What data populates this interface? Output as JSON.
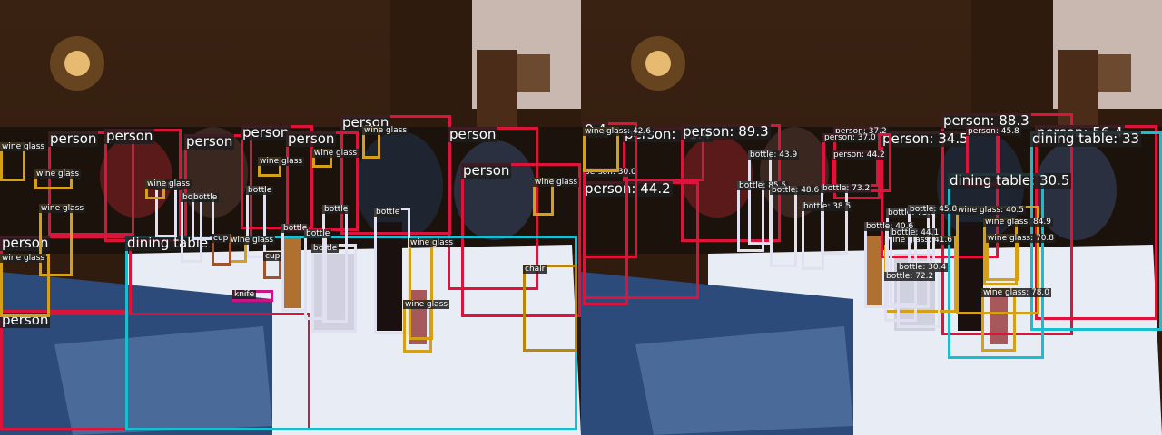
{
  "colors": {
    "person": "#dc143c",
    "dining table": "#17becf",
    "bottle": "#e0e0f0",
    "wine glass": "#d4a017",
    "cup": "#a0522d",
    "knife": "#c71585",
    "chair": "#b8860b"
  },
  "left_panel": {
    "detections": [
      {
        "cls": "person",
        "label": "person"
      },
      {
        "cls": "person",
        "label": "person"
      },
      {
        "cls": "person",
        "label": "person"
      },
      {
        "cls": "person",
        "label": "person"
      },
      {
        "cls": "person",
        "label": "person"
      },
      {
        "cls": "person",
        "label": "person"
      },
      {
        "cls": "person",
        "label": "person"
      },
      {
        "cls": "person",
        "label": "person"
      },
      {
        "cls": "person",
        "label": "person"
      },
      {
        "cls": "person",
        "label": "person"
      },
      {
        "cls": "dining table",
        "label": "dining table"
      },
      {
        "cls": "chair",
        "label": "chair"
      },
      {
        "cls": "bottle",
        "label": "bottle"
      },
      {
        "cls": "bottle",
        "label": "bottle"
      },
      {
        "cls": "bottle",
        "label": "bottle"
      },
      {
        "cls": "bottle",
        "label": "bottle"
      },
      {
        "cls": "bottle",
        "label": "bottle"
      },
      {
        "cls": "bottle",
        "label": "bottle"
      },
      {
        "cls": "bottle",
        "label": "bottle"
      },
      {
        "cls": "bottle",
        "label": "bottle"
      },
      {
        "cls": "bottle",
        "label": "bottle"
      },
      {
        "cls": "wine glass",
        "label": "wine glass"
      },
      {
        "cls": "wine glass",
        "label": "wine glass"
      },
      {
        "cls": "wine glass",
        "label": "wine glass"
      },
      {
        "cls": "wine glass",
        "label": "wine glass"
      },
      {
        "cls": "wine glass",
        "label": "wine glass"
      },
      {
        "cls": "wine glass",
        "label": "wine glass"
      },
      {
        "cls": "wine glass",
        "label": "wine glass"
      },
      {
        "cls": "wine glass",
        "label": "wine glass"
      },
      {
        "cls": "wine glass",
        "label": "wine glass"
      },
      {
        "cls": "wine glass",
        "label": "wine glass"
      },
      {
        "cls": "wine glass",
        "label": "wine glass"
      },
      {
        "cls": "wine glass",
        "label": "wine glass"
      },
      {
        "cls": "cup",
        "label": "cup"
      },
      {
        "cls": "cup",
        "label": "cup"
      },
      {
        "cls": "knife",
        "label": "knife"
      }
    ]
  },
  "right_panel": {
    "detections": [
      {
        "cls": "person",
        "label": "person: 61.4"
      },
      {
        "cls": "person",
        "label": "person: 89.3"
      },
      {
        "cls": "person",
        "label": "person: 88.3"
      },
      {
        "cls": "person",
        "label": "person: 34.5"
      },
      {
        "cls": "person",
        "label": "person: 44.2"
      },
      {
        "cls": "person",
        "label": "person: 30.0"
      },
      {
        "cls": "person",
        "label": "person: 37.2"
      },
      {
        "cls": "person",
        "label": "person: 37.0"
      },
      {
        "cls": "person",
        "label": "person: 44.2"
      },
      {
        "cls": "person",
        "label": "person: 45.8"
      },
      {
        "cls": "person",
        "label": "person: 56.4"
      },
      {
        "cls": "person",
        "label": "0.4"
      },
      {
        "cls": "dining table",
        "label": "dining table: 30.5"
      },
      {
        "cls": "dining table",
        "label": "dining table: 33"
      },
      {
        "cls": "wine glass",
        "label": "wine glass: 42.6"
      },
      {
        "cls": "wine glass",
        "label": "wine glass: 40.5"
      },
      {
        "cls": "wine glass",
        "label": "wine glass: 84.9"
      },
      {
        "cls": "wine glass",
        "label": "wine glass: 70.8"
      },
      {
        "cls": "wine glass",
        "label": "wine glass: 41.6"
      },
      {
        "cls": "wine glass",
        "label": "wine glass: 78.0"
      },
      {
        "cls": "bottle",
        "label": "bottle: 73.7"
      },
      {
        "cls": "bottle",
        "label": "bottle: 43.9"
      },
      {
        "cls": "bottle",
        "label": "bottle: 85.5"
      },
      {
        "cls": "bottle",
        "label": "bottle: 48.6"
      },
      {
        "cls": "bottle",
        "label": "bottle: 73.2"
      },
      {
        "cls": "bottle",
        "label": "bottle: 38.5"
      },
      {
        "cls": "bottle",
        "label": "bottle: 45.8"
      },
      {
        "cls": "bottle",
        "label": "bottle: 40.6"
      },
      {
        "cls": "bottle",
        "label": "bottle: 44.1"
      },
      {
        "cls": "bottle",
        "label": "bottle: 30.4"
      },
      {
        "cls": "bottle",
        "label": "bottle: 72.2"
      }
    ]
  }
}
